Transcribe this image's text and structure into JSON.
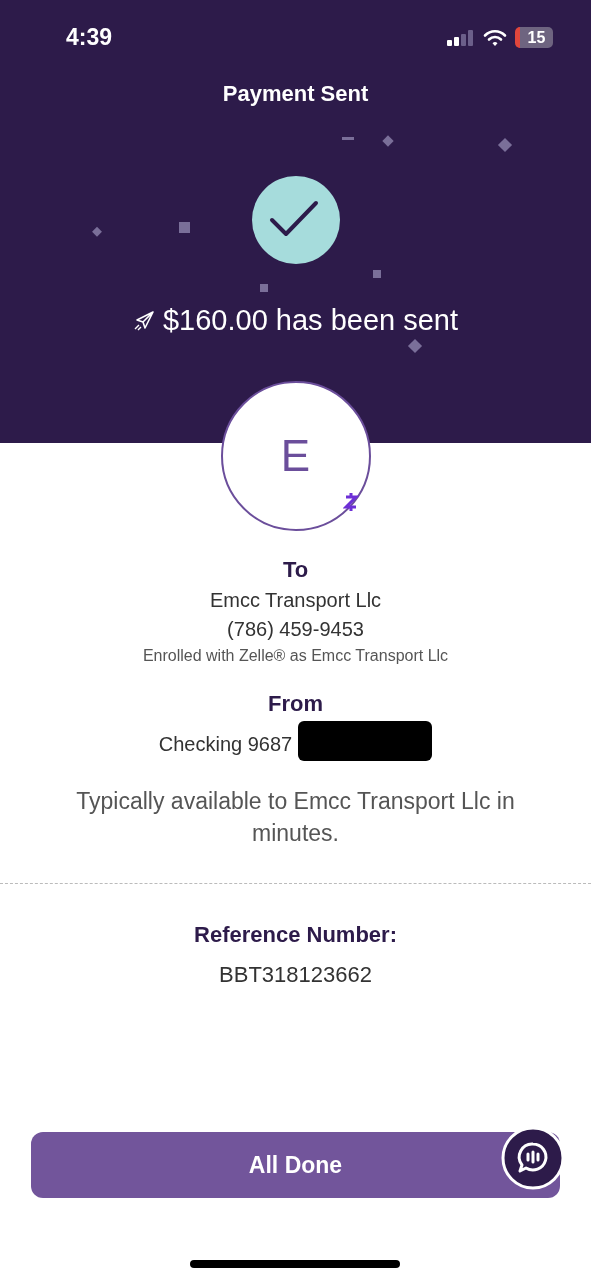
{
  "status_bar": {
    "time": "4:39",
    "battery": "15"
  },
  "header": {
    "title": "Payment Sent",
    "message": "$160.00 has been sent"
  },
  "recipient": {
    "initial": "E"
  },
  "to": {
    "label": "To",
    "name": "Emcc Transport Llc",
    "phone": "(786) 459-9453",
    "enrolled": "Enrolled with Zelle® as Emcc Transport Llc"
  },
  "from": {
    "label": "From",
    "account": "Checking 9687"
  },
  "availability": "Typically available to Emcc Transport Llc in minutes.",
  "reference": {
    "label": "Reference Number:",
    "value": "BBT318123662"
  },
  "buttons": [
    {
      "label": "All Done"
    }
  ]
}
